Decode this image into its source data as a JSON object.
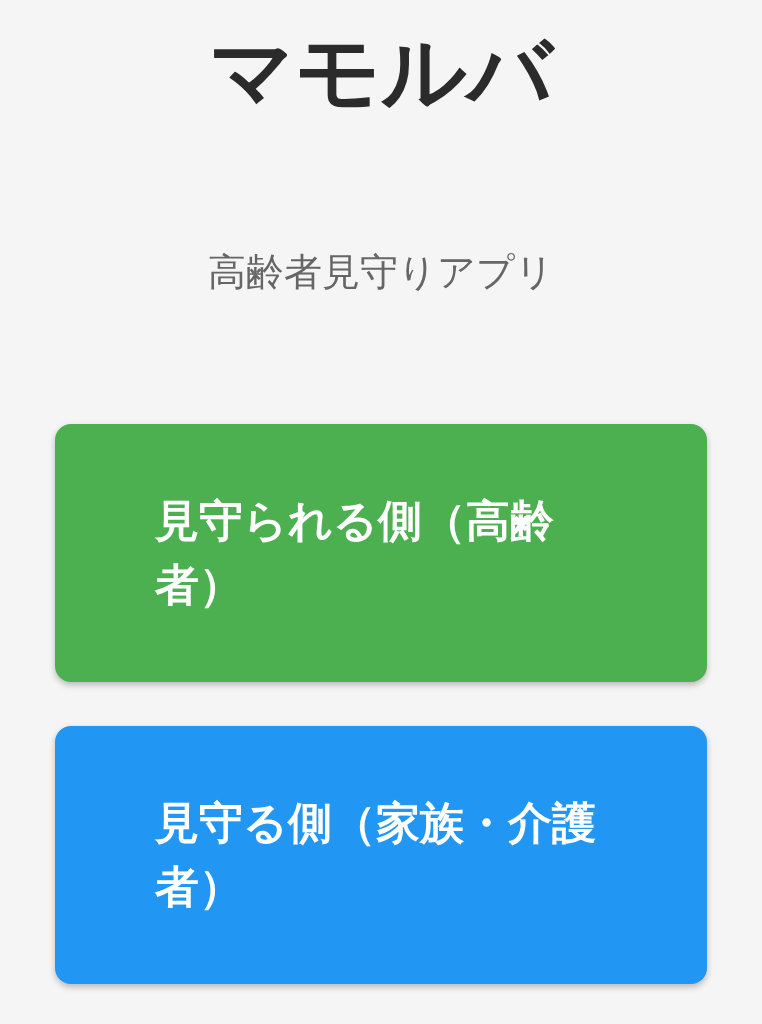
{
  "app_title": "マモルバ",
  "subtitle": "高齢者見守りアプリ",
  "role_buttons": [
    {
      "label": "見守られる側（高齢者）",
      "color": "#4caf50"
    },
    {
      "label": "見守る側（家族・介護者）",
      "color": "#2196f3"
    }
  ]
}
